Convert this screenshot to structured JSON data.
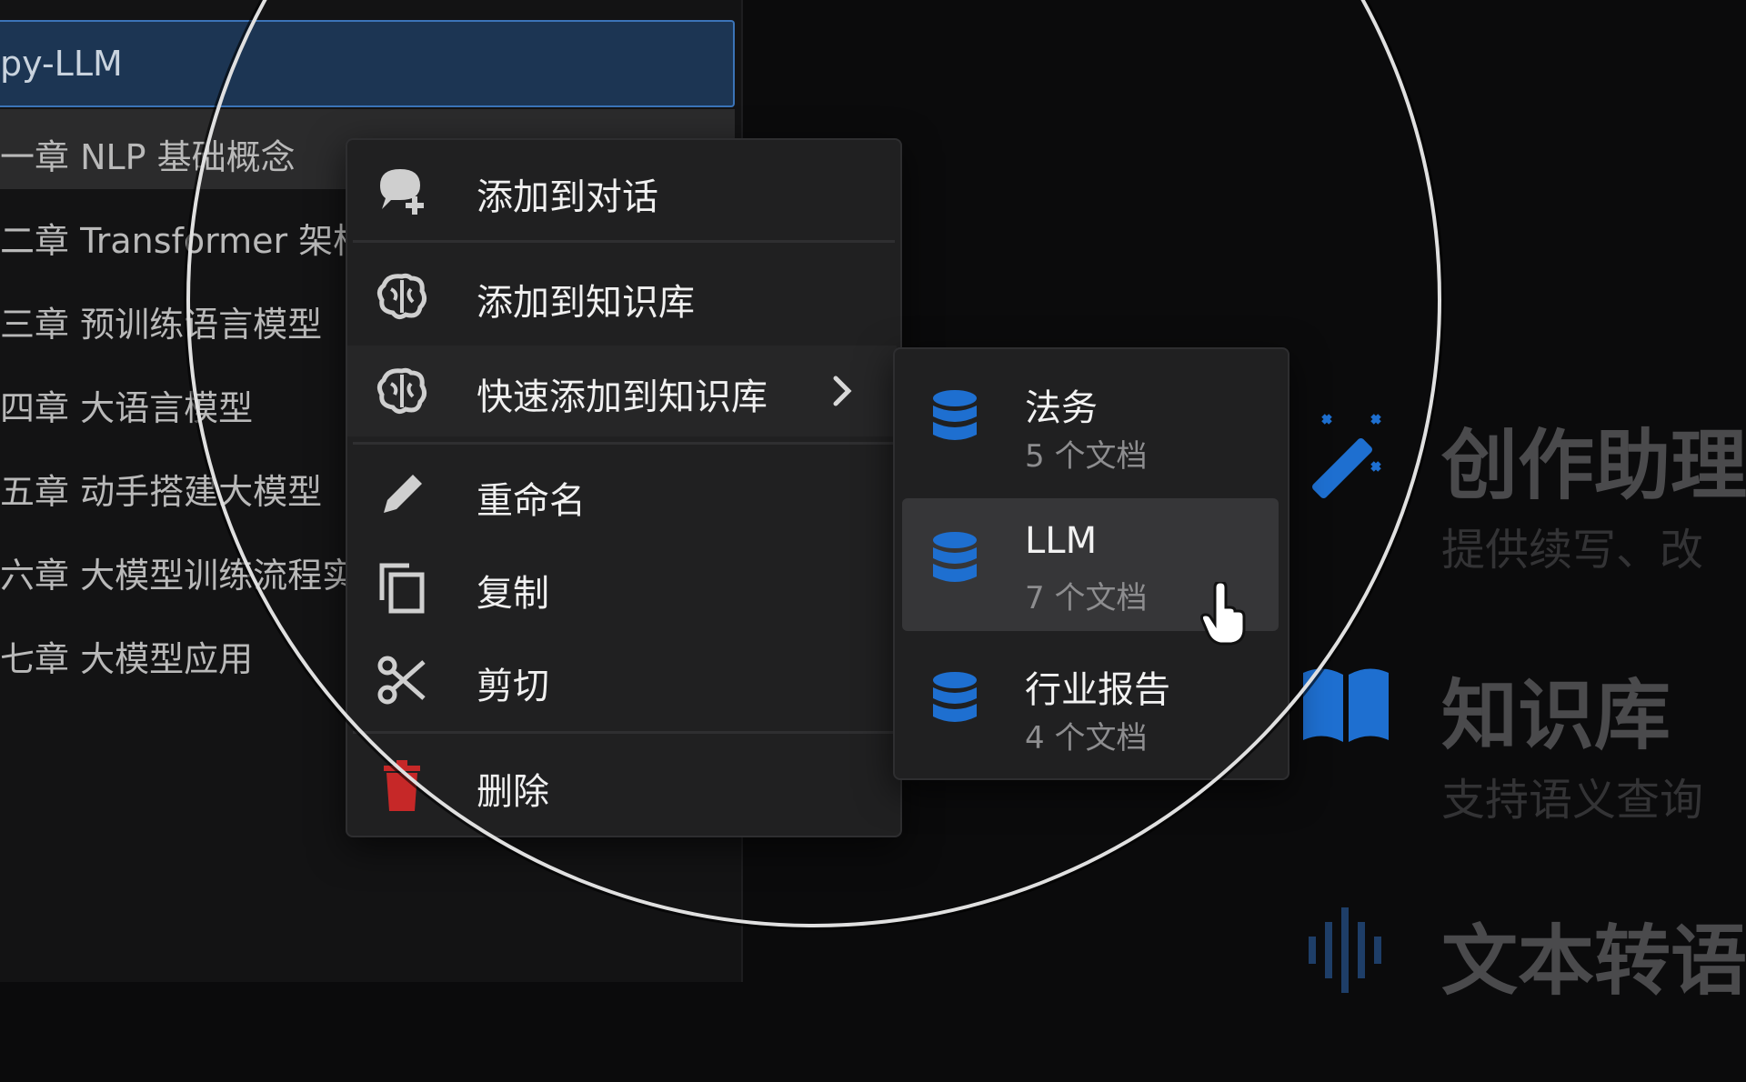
{
  "sidebar": {
    "root_label": "py-LLM",
    "items": [
      {
        "label": "一章 NLP 基础概念"
      },
      {
        "label": "二章 Transformer 架构"
      },
      {
        "label": "三章 预训练语言模型"
      },
      {
        "label": "四章 大语言模型"
      },
      {
        "label": "五章 动手搭建大模型"
      },
      {
        "label": "六章 大模型训练流程实"
      },
      {
        "label": "七章 大模型应用"
      }
    ]
  },
  "context_menu": {
    "items": [
      {
        "label": "添加到对话",
        "icon": "chat-add-icon"
      },
      {
        "label": "添加到知识库",
        "icon": "brain-icon"
      },
      {
        "label": "快速添加到知识库",
        "icon": "brain-icon",
        "has_submenu": true
      },
      {
        "label": "重命名",
        "icon": "pencil-icon"
      },
      {
        "label": "复制",
        "icon": "copy-icon"
      },
      {
        "label": "剪切",
        "icon": "scissors-icon"
      },
      {
        "label": "删除",
        "icon": "trash-icon",
        "color": "#c62828"
      }
    ]
  },
  "submenu": {
    "items": [
      {
        "name": "法务",
        "count": "5 个文档",
        "active": false
      },
      {
        "name": "LLM",
        "count": "7 个文档",
        "active": true
      },
      {
        "name": "行业报告",
        "count": "4 个文档",
        "active": false
      }
    ]
  },
  "features": [
    {
      "title": "创作助理",
      "desc": "提供续写、改",
      "icon": "magic-wand-icon"
    },
    {
      "title": "知识库",
      "desc": "支持语义查询",
      "icon": "book-icon"
    },
    {
      "title": "文本转语",
      "desc": "",
      "icon": "audio-wave-icon"
    }
  ],
  "colors": {
    "accent": "#1e6fd0",
    "danger": "#c62828",
    "menu_bg": "#202021",
    "selection_bg": "#1c3553"
  }
}
